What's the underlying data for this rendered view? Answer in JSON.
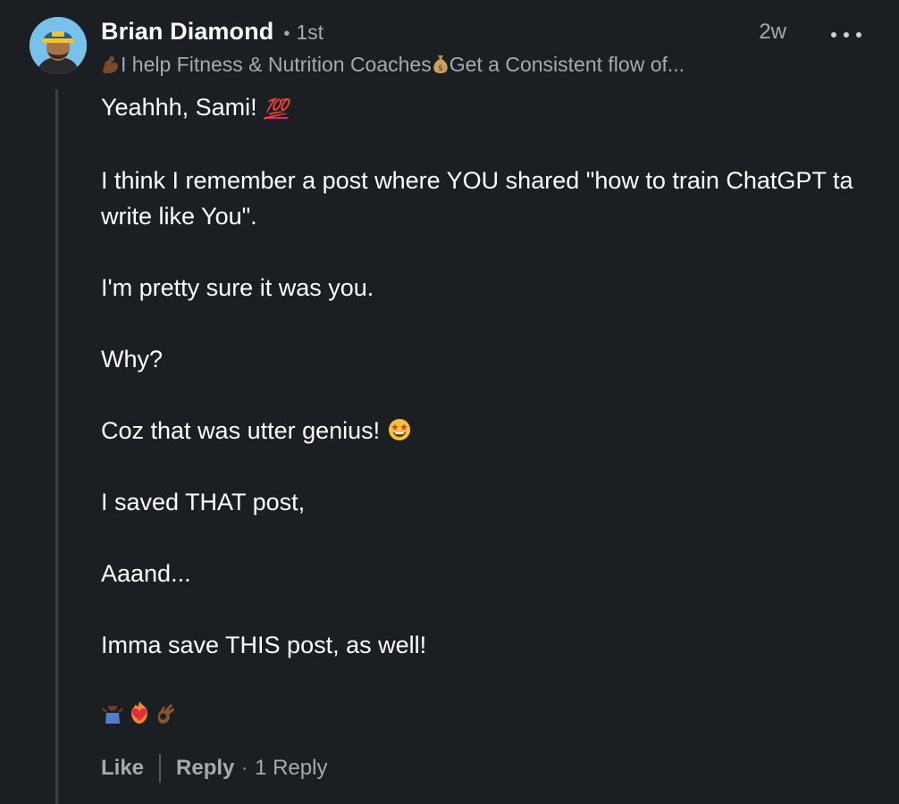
{
  "author": {
    "name": "Brian Diamond",
    "degree": "1st",
    "separator": "•",
    "headline_part1": "I help Fitness & Nutrition Coaches ",
    "headline_part2": "Get a Consistent flow of..."
  },
  "timestamp": "2w",
  "icons": {
    "more": "more-options-icon",
    "flexed_arm": "flexed-biceps-emoji",
    "money_bag": "money-bag-emoji",
    "hundred": "hundred-points-emoji",
    "star_struck": "star-struck-emoji",
    "shrug": "person-shrugging-emoji",
    "heart_on_fire": "heart-on-fire-emoji",
    "ok_hand": "ok-hand-emoji"
  },
  "comment": {
    "p1_text": "Yeahhh, Sami! ",
    "p1_emoji": "💯",
    "p2": "I think I remember a post where YOU shared \"how to train ChatGPT ta write like You\".",
    "p3": "I'm pretty sure it was you.",
    "p4": "Why?",
    "p5_text": "Coz that was utter genius! ",
    "p6": "I saved THAT post,",
    "p7": "Aaand...",
    "p8": "Imma save THIS post, as well!"
  },
  "actions": {
    "like": "Like",
    "reply": "Reply",
    "dot": "·",
    "reply_count": "1 Reply"
  }
}
